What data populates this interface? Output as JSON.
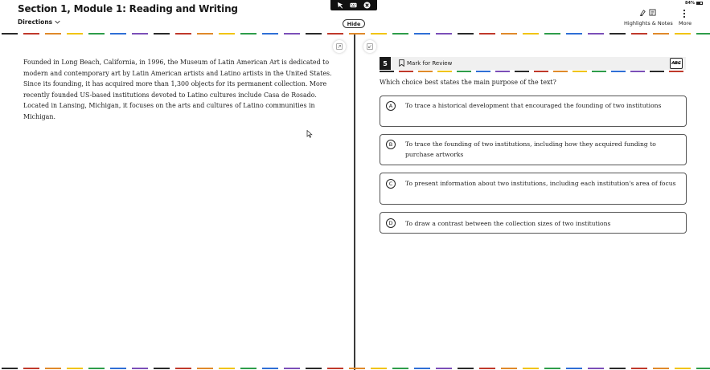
{
  "header": {
    "section_title": "Section 1, Module 1: Reading and Writing",
    "directions_label": "Directions",
    "hide_label": "Hide",
    "battery_text": "84%",
    "highlights_label": "Highlights & Notes",
    "more_label": "More"
  },
  "passage": {
    "text": "Founded in Long Beach, California, in 1996, the Museum of Latin American Art is dedicated to modern and contemporary art by Latin American artists and Latino artists in the United States. Since its founding, it has acquired more than 1,300 objects for its permanent collection. More recently founded US-based institutions devoted to Latino cultures include Casa de Rosado. Located in Lansing, Michigan, it focuses on the arts and cultures of Latino communities in Michigan."
  },
  "question": {
    "number": "5",
    "mark_for_review_label": "Mark for Review",
    "abc_label": "ABC",
    "prompt": "Which choice best states the main purpose of the text?",
    "choices": [
      {
        "letter": "A",
        "text": "To trace a historical development that encouraged the founding of two institutions"
      },
      {
        "letter": "B",
        "text": "To trace the founding of two institutions, including how they acquired funding to purchase artworks"
      },
      {
        "letter": "C",
        "text": "To present information about two institutions, including each institution's area of focus"
      },
      {
        "letter": "D",
        "text": "To draw a contrast between the collection sizes of two institutions"
      }
    ]
  },
  "colors": {
    "accent_dashes": [
      "#2a2a2a",
      "#c0392b",
      "#e08a2a",
      "#f1c40f",
      "#2e9d4a",
      "#2f6fd6",
      "#7b4fb8"
    ],
    "divider": "#3a3a3a",
    "choice_border": "#555555"
  },
  "icons": {
    "directions_chevron": "chevron-down-icon",
    "toolbar_1": "pointer-icon",
    "toolbar_2": "keyboard-icon",
    "toolbar_3": "close-circle-icon",
    "highlighter": "highlighter-icon",
    "notes": "notes-icon",
    "more": "vertical-dots-icon",
    "bookmark": "bookmark-icon",
    "expand": "expand-icon",
    "collapse": "collapse-icon"
  }
}
